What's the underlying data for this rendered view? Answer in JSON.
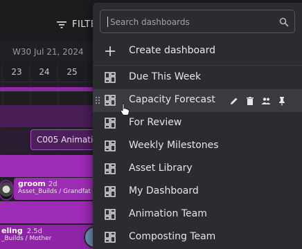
{
  "toolbar": {
    "filter_label": "FILTE"
  },
  "timeline": {
    "week_label": "W30 Jul 21, 2024",
    "days": [
      "23",
      "24",
      "25"
    ],
    "tasks": [
      {
        "title": "C005 Animatio"
      },
      {
        "title": "groom",
        "duration": "2d",
        "path": "Asset_Builds / Grandfat"
      },
      {
        "title": "eling",
        "duration": "2.5d",
        "path": "_Builds / Mother"
      }
    ]
  },
  "menu": {
    "search_placeholder": "Search dashboards",
    "create_label": "Create dashboard",
    "items": [
      {
        "label": "Due This Week"
      },
      {
        "label": "Capacity Forecast"
      },
      {
        "label": "For Review"
      },
      {
        "label": "Weekly Milestones"
      },
      {
        "label": "Asset Library"
      },
      {
        "label": "My Dashboard"
      },
      {
        "label": "Animation Team"
      },
      {
        "label": "Composting Team"
      }
    ],
    "hover_actions": [
      "edit-icon",
      "delete-icon",
      "share-users-icon",
      "pin-icon"
    ]
  },
  "colors": {
    "menu_bg": "#2b2c30",
    "hover_bg": "#3a3b40",
    "task_purple": "#9d2bb5",
    "text": "#e6e6e8"
  }
}
